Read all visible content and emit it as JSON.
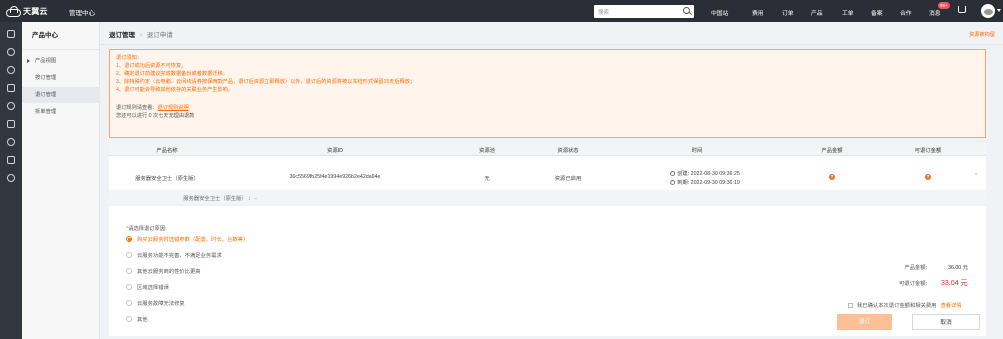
{
  "topbar": {
    "brand": "天翼云",
    "console": "管理中心",
    "search_placeholder": "搜索",
    "nav": [
      "中国站",
      "费用",
      "订单",
      "产品",
      "工单",
      "备案",
      "合作",
      "消息"
    ],
    "badge": "99+"
  },
  "sidebar": {
    "title": "产品中心",
    "items": [
      "产品视图",
      "按订管理",
      "退订管理",
      "拆单管理"
    ],
    "selected_index": 2
  },
  "breadcrumb": {
    "root": "退订管理",
    "current": "退订申请"
  },
  "guide_link": "资源被拘留",
  "notice": {
    "title": "退订须知：",
    "lines": [
      "1、退订成功后资源不可恢复。",
      "2、确定退订前建议完成数据备份或者数据迁移。",
      "3、除特殊约定（云电脑、云间线请券按保两款产品，退订后资源立即释放）以外，退订后的资源将被以冻结形式保留15天后释放；",
      "4、退订可能会导致其他依存的关联业务产生影响。"
    ],
    "rules_prefix": "退订规则请查看：",
    "rules_link": "退订规则说明",
    "remaining_text": "您还可以进行 0 次七天无理由退款"
  },
  "table": {
    "headers": [
      "产品名称",
      "资源ID",
      "资源池",
      "资源状态",
      "时间",
      "产品金额",
      "可退订金额"
    ],
    "row": {
      "name": "服务器安全卫士（原生版）",
      "id": "36c5569fb25f4e1994e926b2e42da94e",
      "pool": "无",
      "status": "资源已启用",
      "created": "创建: 2022-08-30 09:36:25",
      "expires": "到期: 2022-09-30 09:36:19"
    },
    "subrow": "服务器安全卫士（原生版） ：  -"
  },
  "form": {
    "reason_title": "请选择退订原因:",
    "reasons": [
      "购买云服务时选错参数（配置、时长、台数等）",
      "云服务功能不完善、不满足业务需求",
      "其他云服务商的性价比更高",
      "区域选择错误",
      "云服务故障无法修复",
      "其他"
    ],
    "selected_reason": 0,
    "product_amount_label": "产品金额:",
    "product_amount": "36.00 元",
    "refund_amount_label": "可退订金额:",
    "refund_amount": "33.04 元",
    "confirm_text": "我已确认本次退订金额和相关费用",
    "confirm_link": "查看详情",
    "submit_label": "退订",
    "cancel_label": "取消"
  },
  "colors": {
    "accent": "#ff6a00",
    "topbar": "#2b2e36",
    "refund": "#f5222d"
  }
}
